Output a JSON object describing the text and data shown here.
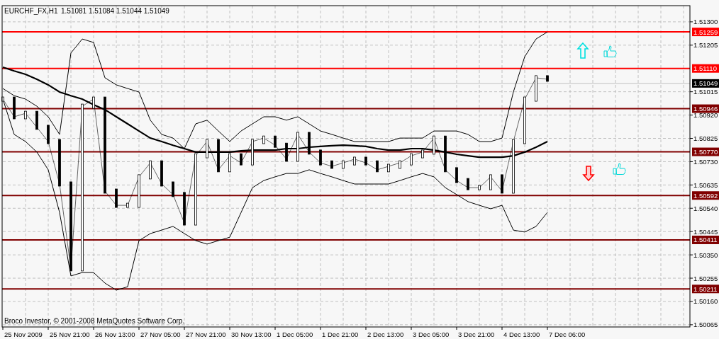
{
  "chart": {
    "title": "EURCHF_FX,H1",
    "ohlc": [
      "1.51081",
      "1.51084",
      "1.51044",
      "1.51049"
    ],
    "copyright": "Broco Investor, © 2001-2008 MetaQuotes Software Corp.",
    "price_labels": [
      "1.51300",
      "1.51205",
      "1.51015",
      "1.50920",
      "1.50825",
      "1.50730",
      "1.50635",
      "1.50540",
      "1.50445",
      "1.50350",
      "1.50255",
      "1.50160",
      "1.50065"
    ],
    "time_labels": [
      "25 Nov 2009",
      "25 Nov 21:00",
      "26 Nov 13:00",
      "27 Nov 05:00",
      "27 Nov 21:00",
      "30 Nov 13:00",
      "1 Dec 05:00",
      "1 Dec 21:00",
      "2 Dec 13:00",
      "3 Dec 05:00",
      "3 Dec 21:00",
      "4 Dec 13:00",
      "7 Dec 06:00"
    ],
    "last_price": "1.51049",
    "levels": [
      {
        "label": "1.51259",
        "color": "#ff0000"
      },
      {
        "label": "1.51110",
        "color": "#ff0000"
      },
      {
        "label": "1.50946",
        "color": "#800000"
      },
      {
        "label": "1.50770",
        "color": "#800000"
      },
      {
        "label": "1.50592",
        "color": "#800000"
      },
      {
        "label": "1.50411",
        "color": "#800000"
      },
      {
        "label": "1.50211",
        "color": "#800000"
      }
    ]
  }
}
